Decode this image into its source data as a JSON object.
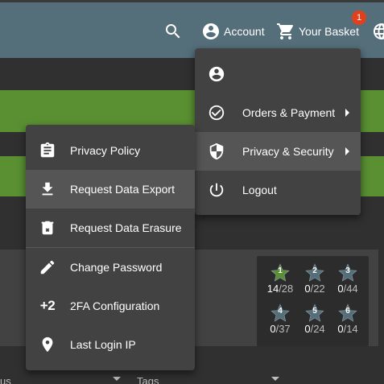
{
  "toolbar": {
    "account_label": "Account",
    "basket_label": "Your Basket",
    "basket_count": "1",
    "background": "#546e7a"
  },
  "account_menu": {
    "items": [
      {
        "label": "",
        "icon": "account-circle-icon"
      },
      {
        "label": "Orders & Payment",
        "icon": "check-circle-icon"
      },
      {
        "label": "Privacy & Security",
        "icon": "shield-icon"
      },
      {
        "label": "Logout",
        "icon": "power-icon"
      }
    ]
  },
  "privacy_menu": {
    "items": [
      {
        "label": "Privacy Policy",
        "icon": "clipboard-icon"
      },
      {
        "label": "Request Data Export",
        "icon": "download-icon"
      },
      {
        "label": "Request Data Erasure",
        "icon": "delete-icon"
      },
      {
        "label": "Change Password",
        "icon": "pencil-icon"
      },
      {
        "label": "2FA Configuration",
        "icon": "plus-two-icon",
        "icon_text": "+2"
      },
      {
        "label": "Last Login IP",
        "icon": "location-pin-icon"
      }
    ]
  },
  "challenge_stars": [
    {
      "level": "1",
      "solved": "14",
      "total": "/28",
      "color": "#5a9032"
    },
    {
      "level": "2",
      "solved": "0",
      "total": "/22",
      "color": "#546e7a"
    },
    {
      "level": "3",
      "solved": "0",
      "total": "/44",
      "color": "#546e7a"
    },
    {
      "level": "4",
      "solved": "0",
      "total": "/37",
      "color": "#546e7a"
    },
    {
      "level": "5",
      "solved": "0",
      "total": "/24",
      "color": "#546e7a"
    },
    {
      "level": "6",
      "solved": "0",
      "total": "/14",
      "color": "#546e7a"
    }
  ],
  "filters": {
    "status_label": "us",
    "tags_label": "Tags"
  },
  "colors": {
    "accent_green": "#5a9032",
    "menu_bg": "#424242",
    "page_bg": "#303030",
    "badge": "#e2401c"
  }
}
